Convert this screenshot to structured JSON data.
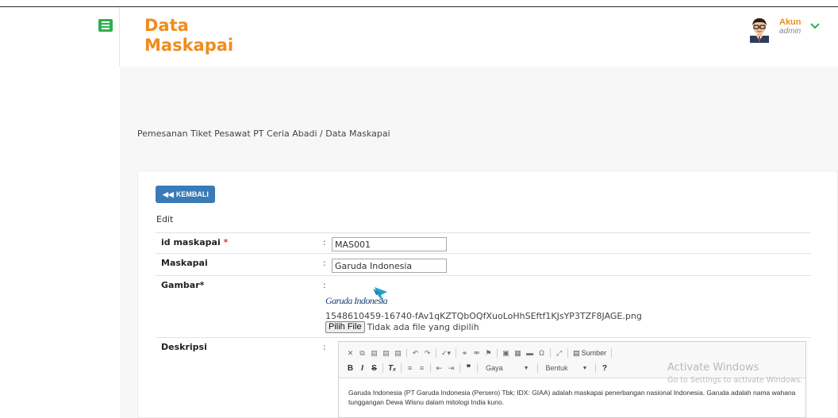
{
  "header": {
    "title_line1": "Data",
    "title_line2": "Maskapai",
    "menu_icon": "hamburger-menu-icon",
    "account": {
      "name": "Akun",
      "role": "admin",
      "avatar_icon": "user-avatar-icon",
      "dropdown_icon": "chevron-down-icon"
    }
  },
  "breadcrumb": "Pemesanan Tiket Pesawat PT Ceria Abadi / Data Maskapai",
  "actions": {
    "back_label": "KEMBALI",
    "back_icon": "double-chevron-left-icon"
  },
  "form": {
    "mode_label": "Edit",
    "colon": ":",
    "fields": {
      "id": {
        "label": "id maskapai",
        "required_mark": "*",
        "value": "MAS001"
      },
      "name": {
        "label": "Maskapai",
        "value": "Garuda Indonesia"
      },
      "image": {
        "label": "Gambar*",
        "logo_text": "Garuda Indonesia",
        "filename": "1548610459-16740-fAv1qKZTQbOQfXuoLoHhSEftf1KJsYP3TZF8JAGE.png",
        "choose_button": "Pilih File",
        "choose_status": "Tidak ada file yang dipilih"
      },
      "description": {
        "label": "Deskripsi",
        "toolbar": {
          "style_combo": "Gaya",
          "format_combo": "Bentuk",
          "source_label": "Sumber",
          "help_label": "?"
        },
        "content": "Garuda Indonesia (PT Garuda Indonesia (Persero) Tbk; IDX: GIAA) adalah maskapai penerbangan nasional Indonesia. Garuda adalah nama wahana tunggangan Dewa Wisnu dalam mitologi India kuno."
      }
    }
  },
  "watermark": {
    "title": "Activate Windows",
    "subtitle": "Go to Settings to activate Windows."
  },
  "colors": {
    "accent": "#f08c1c",
    "menu_green": "#2bb24c",
    "button_blue": "#3a7ab7",
    "required_red": "#e03434"
  }
}
